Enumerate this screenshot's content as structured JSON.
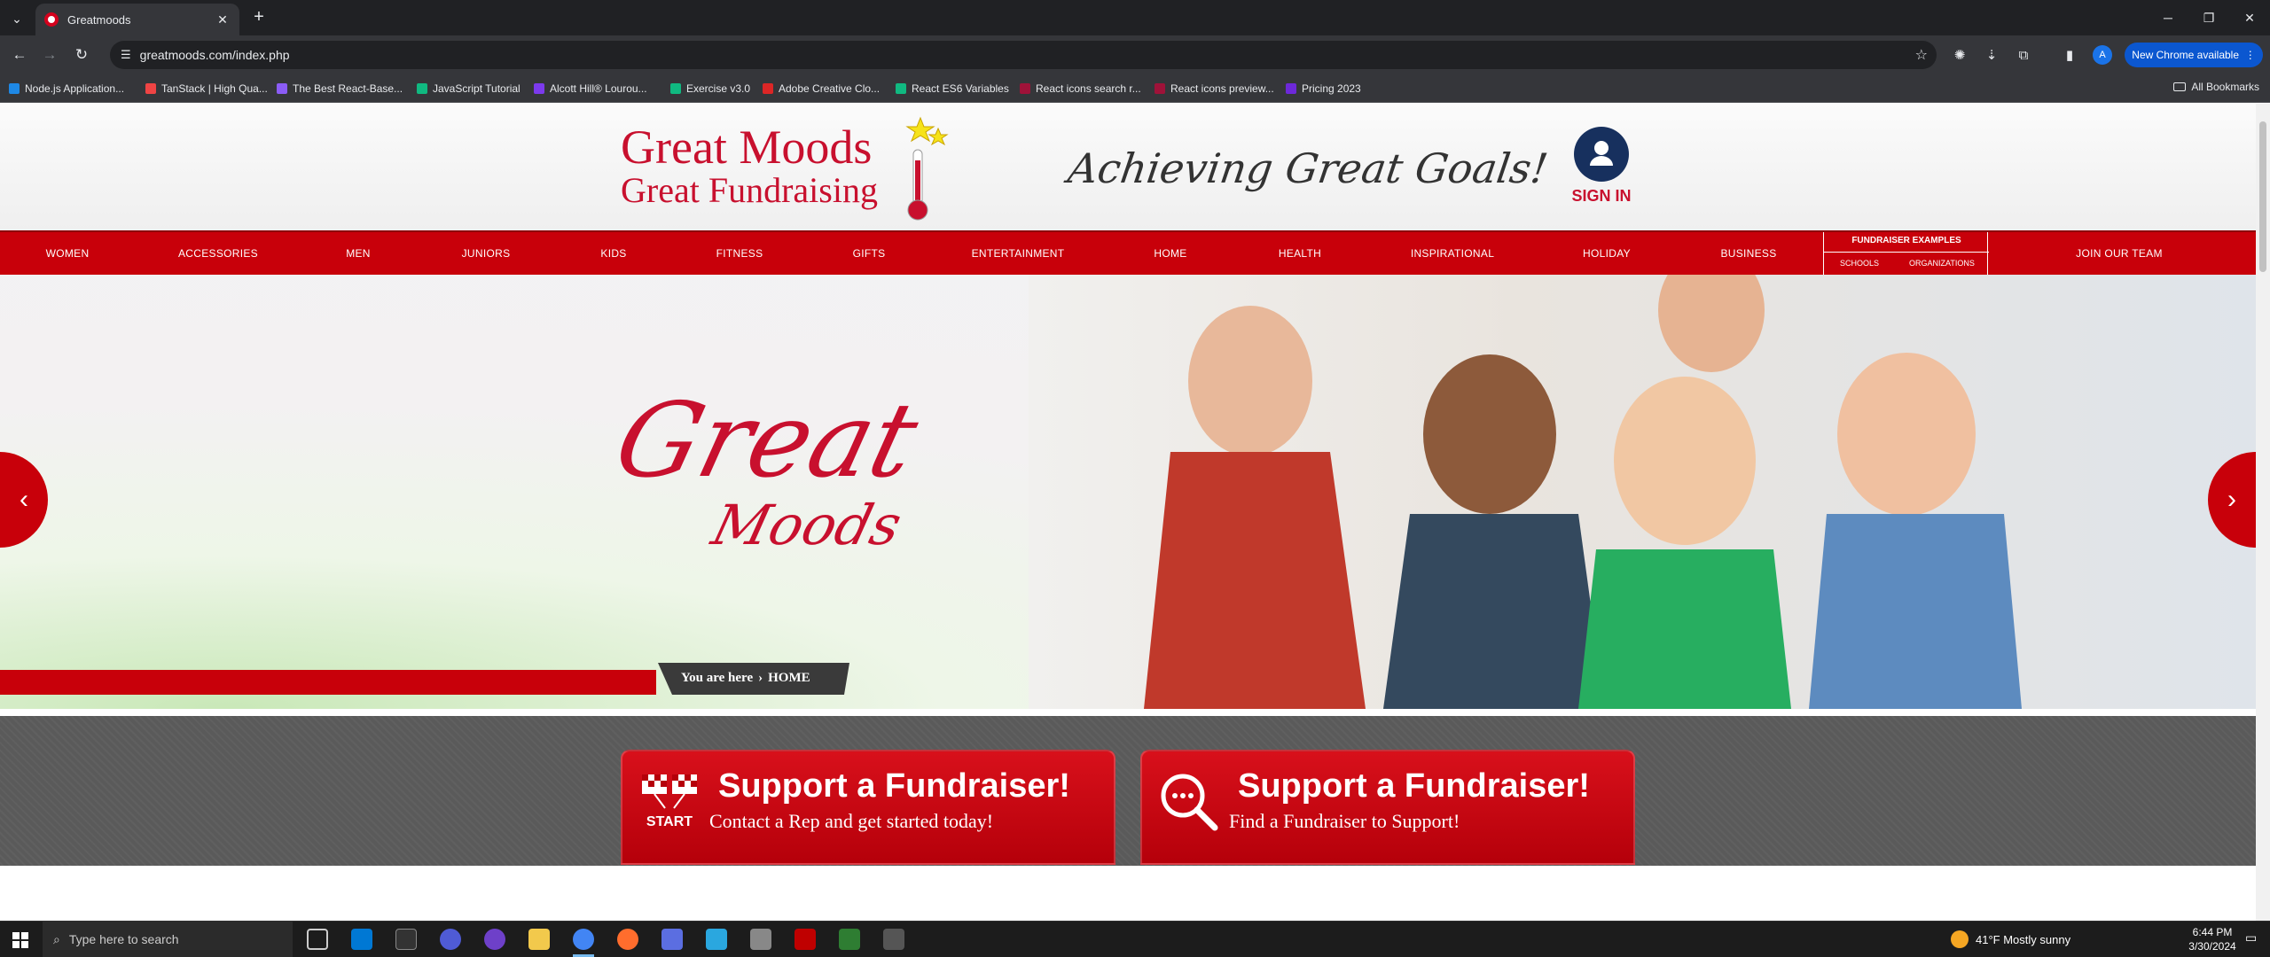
{
  "browser": {
    "tab_title": "Greatmoods",
    "url": "greatmoods.com/index.php",
    "update_button": "New Chrome available",
    "profile_initial": "A",
    "bookmarks": [
      {
        "label": "Node.js Application...",
        "color": "#1e88e5"
      },
      {
        "label": "TanStack | High Qua...",
        "color": "#ef4444"
      },
      {
        "label": "The Best React-Base...",
        "color": "#8b5cf6"
      },
      {
        "label": "JavaScript Tutorial",
        "color": "#10b981"
      },
      {
        "label": "Alcott Hill® Lourou...",
        "color": "#7c3aed"
      },
      {
        "label": "Exercise v3.0",
        "color": "#10b981"
      },
      {
        "label": "Adobe Creative Clo...",
        "color": "#dc2626"
      },
      {
        "label": "React ES6 Variables",
        "color": "#10b981"
      },
      {
        "label": "React icons search r...",
        "color": "#9f1239"
      },
      {
        "label": "React icons preview...",
        "color": "#9f1239"
      },
      {
        "label": "Pricing 2023",
        "color": "#6d28d9"
      }
    ],
    "all_bookmarks": "All Bookmarks"
  },
  "site": {
    "logo_line1": "Great Moods",
    "logo_line2": "Great Fundraising",
    "tagline": "Achieving Great Goals!",
    "signin_label": "SIGN IN",
    "nav": [
      "WOMEN",
      "ACCESSORIES",
      "MEN",
      "JUNIORS",
      "KIDS",
      "FITNESS",
      "GIFTS",
      "ENTERTAINMENT",
      "HOME",
      "HEALTH",
      "INSPIRATIONAL",
      "HOLIDAY",
      "BUSINESS"
    ],
    "fundraiser_examples": {
      "title": "FUNDRAISER EXAMPLES",
      "schools": "SCHOOLS",
      "organizations": "ORGANIZATIONS"
    },
    "join_team": "JOIN OUR TEAM",
    "hero": {
      "big": "Great",
      "small": "Moods"
    },
    "breadcrumb": {
      "prefix": "You are here",
      "current": "HOME"
    },
    "cta": [
      {
        "title": "Support a Fundraiser!",
        "subtitle": "Contact a Rep and get started today!",
        "icon": "start-flags-icon",
        "icon_text": "START"
      },
      {
        "title": "Support a Fundraiser!",
        "subtitle": "Find a Fundraiser to Support!",
        "icon": "search-chat-icon"
      }
    ],
    "brand_red": "#c8000a"
  },
  "taskbar": {
    "search_placeholder": "Type here to search",
    "weather": "41°F  Mostly sunny",
    "time": "6:44 PM",
    "date": "3/30/2024"
  }
}
